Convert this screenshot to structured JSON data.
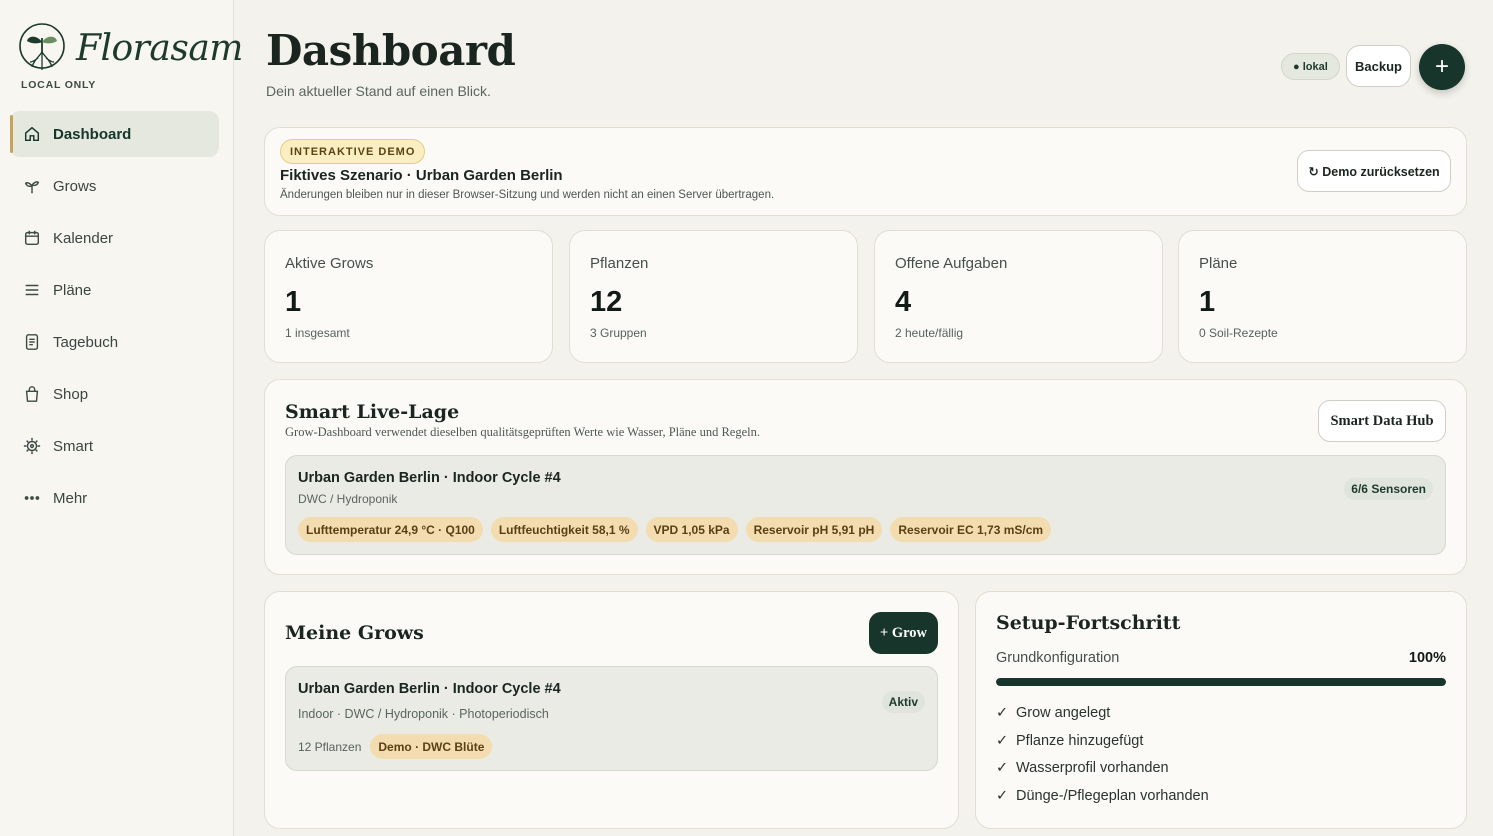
{
  "brand": {
    "name": "Florasam",
    "tagline": "LOCAL ONLY"
  },
  "nav": [
    {
      "label": "Dashboard",
      "icon": "home-icon",
      "active": true
    },
    {
      "label": "Grows",
      "icon": "sprout-icon"
    },
    {
      "label": "Kalender",
      "icon": "calendar-icon"
    },
    {
      "label": "Pläne",
      "icon": "list-icon"
    },
    {
      "label": "Tagebuch",
      "icon": "notebook-icon"
    },
    {
      "label": "Shop",
      "icon": "shopping-bag-icon"
    },
    {
      "label": "Smart",
      "icon": "sensor-icon"
    },
    {
      "label": "Mehr",
      "icon": "more-dots-icon"
    }
  ],
  "header": {
    "title": "Dashboard",
    "subtitle": "Dein aktueller Stand auf einen Blick.",
    "status_pill": "● lokal",
    "backup_label": "Backup",
    "add_label": "+"
  },
  "demo": {
    "badge": "INTERAKTIVE DEMO",
    "title": "Fiktives Szenario · Urban Garden Berlin",
    "text": "Änderungen bleiben nur in dieser Browser-Sitzung und werden nicht an einen Server übertragen.",
    "reset_label": "↻ Demo zurücksetzen"
  },
  "stats": [
    {
      "label": "Aktive Grows",
      "value": "1",
      "sub": "1 insgesamt"
    },
    {
      "label": "Pflanzen",
      "value": "12",
      "sub": "3 Gruppen"
    },
    {
      "label": "Offene Aufgaben",
      "value": "4",
      "sub": "2 heute/fällig"
    },
    {
      "label": "Pläne",
      "value": "1",
      "sub": "0 Soil-Rezepte"
    }
  ],
  "smart": {
    "title": "Smart Live-Lage",
    "description": "Grow-Dashboard verwendet dieselben qualitätsgeprüften Werte wie Wasser, Pläne und Regeln.",
    "hub_label": "Smart Data Hub",
    "grow_title": "Urban Garden Berlin · Indoor Cycle #4",
    "grow_sub": "DWC / Hydroponik",
    "sensor_count": "6/6 Sensoren",
    "chips": [
      "Lufttemperatur 24,9 °C · Q100",
      "Luftfeuchtigkeit 58,1 %",
      "VPD 1,05 kPa",
      "Reservoir pH 5,91 pH",
      "Reservoir EC 1,73 mS/cm"
    ]
  },
  "grows": {
    "title": "Meine Grows",
    "add_label": "+ Grow",
    "item": {
      "title": "Urban Garden Berlin · Indoor Cycle #4",
      "meta": "Indoor · DWC / Hydroponik · Photoperiodisch",
      "status": "Aktiv",
      "plants": "12 Pflanzen",
      "plan_chip": "Demo · DWC Blüte"
    }
  },
  "setup": {
    "title": "Setup-Fortschritt",
    "progress_label": "Grundkonfiguration",
    "progress_pct": "100%",
    "progress_value": 1.0,
    "checks": [
      "Grow angelegt",
      "Pflanze hinzugefügt",
      "Wasserprofil vorhanden",
      "Dünge-/Pflegeplan vorhanden"
    ]
  },
  "colors": {
    "primary": "#17352a",
    "accent": "#c9a15a",
    "chip": "#f3ddb0"
  }
}
